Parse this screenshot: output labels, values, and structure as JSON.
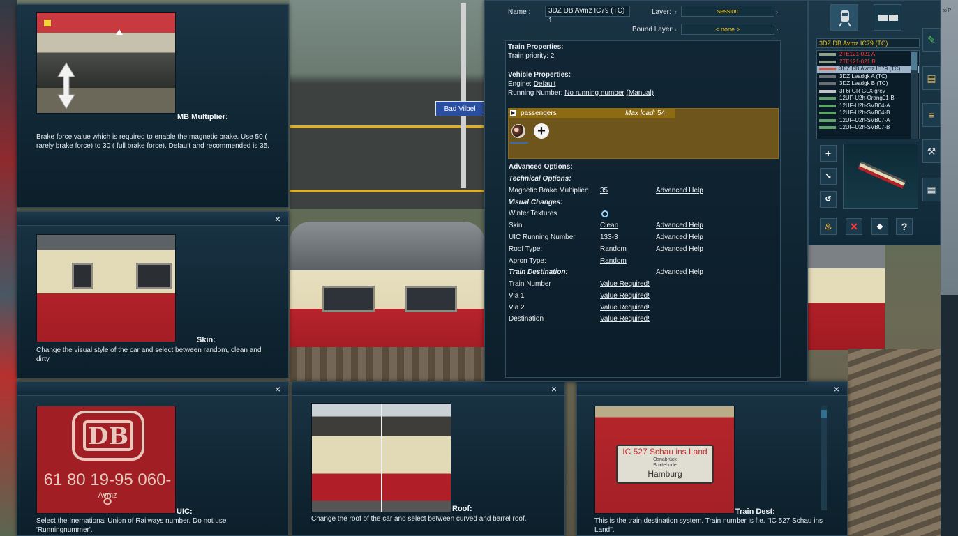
{
  "scene": {
    "station_sign": "Bad Vilbel",
    "edge_text": "to P"
  },
  "help_brake": {
    "heading": "MB Multiplier:",
    "text": "Brake force value which is required to enable the magnetic brake. Use 50 ( rarely brake force) to 30 ( full brake force). Default and recommended is 35."
  },
  "help_skin": {
    "heading": "Skin:",
    "text": "Change the visual style of the car and select between random, clean and dirty."
  },
  "help_uic": {
    "heading": "UIC:",
    "text": "Select the Inernational Union of Railways number. Do not use 'Runningnummer'.",
    "number_image_text": "61 80 19-95 060-8",
    "sub_image_text": "Avmz",
    "logo_text": "DB"
  },
  "help_roof": {
    "heading": "Roof:",
    "text": "Change the roof of the car and select between curved and barrel roof."
  },
  "help_dest": {
    "heading": "Train Dest:",
    "text": "This is the train destination system. Train number is f.e. \"IC 527 Schau ins Land\".",
    "plate_line1": "IC 527 Schau ins Land",
    "plate_line2": "Osnabrück\nBuxtehude",
    "plate_line3": "Hamburg"
  },
  "close_symbol": "×",
  "props": {
    "name_label": "Name :",
    "name_value": "3DZ DB Avmz IC79 (TC) 1",
    "layer_label": "Layer:",
    "layer_value": "session",
    "bound_layer_label": "Bound Layer:",
    "bound_layer_value": "< none >",
    "train_properties": "Train Properties:",
    "train_priority_label": "Train priority:",
    "train_priority_value": "2",
    "vehicle_properties": "Vehicle Properties:",
    "engine_label": "Engine:",
    "engine_value": "Default",
    "running_number_label": "Running Number:",
    "running_number_value": "No running number",
    "manual_label": "(Manual)",
    "load_name": "passengers",
    "max_load_label": "Max load:",
    "max_load_value": "54",
    "advanced_options": "Advanced Options:",
    "technical_options": "Technical Options:",
    "mb_label": "Magnetic Brake Multiplier:",
    "mb_value": "35",
    "advanced_help": "Advanced Help",
    "visual_changes": "Visual Changes:",
    "winter_label": "Winter Textures",
    "skin_label": "Skin",
    "skin_value": "Clean",
    "uic_label": "UIC Running Number",
    "uic_value": "133-3",
    "roof_label": "Roof Type:",
    "roof_value": "Random",
    "apron_label": "Apron Type:",
    "apron_value": "Random",
    "train_destination": "Train Destination:",
    "train_number_label": "Train Number",
    "via1_label": "Via 1",
    "via2_label": "Via 2",
    "destination_label": "Destination",
    "value_required": "Value Required!"
  },
  "asset": {
    "title": "3DZ DB Avmz IC79 (TC)",
    "items": [
      {
        "label": "2TE121-021 A",
        "style": "red"
      },
      {
        "label": "2TE121-021 B",
        "style": "red"
      },
      {
        "label": "3DZ DB Avmz IC79 (TC)",
        "style": "sel"
      },
      {
        "label": "3DZ Leadgk A (TC)",
        "style": ""
      },
      {
        "label": "3DZ Leadgk B (TC)",
        "style": ""
      },
      {
        "label": "3F6i GR GLX grey",
        "style": ""
      },
      {
        "label": "12UF-U2h-Orang01-B",
        "style": ""
      },
      {
        "label": "12UF-U2h-SVB04-A",
        "style": ""
      },
      {
        "label": "12UF-U2h-SVB04-B",
        "style": ""
      },
      {
        "label": "12UF-U2h-SVB07-A",
        "style": ""
      },
      {
        "label": "12UF-U2h-SVB07-B",
        "style": ""
      }
    ],
    "help_btn": "?"
  }
}
